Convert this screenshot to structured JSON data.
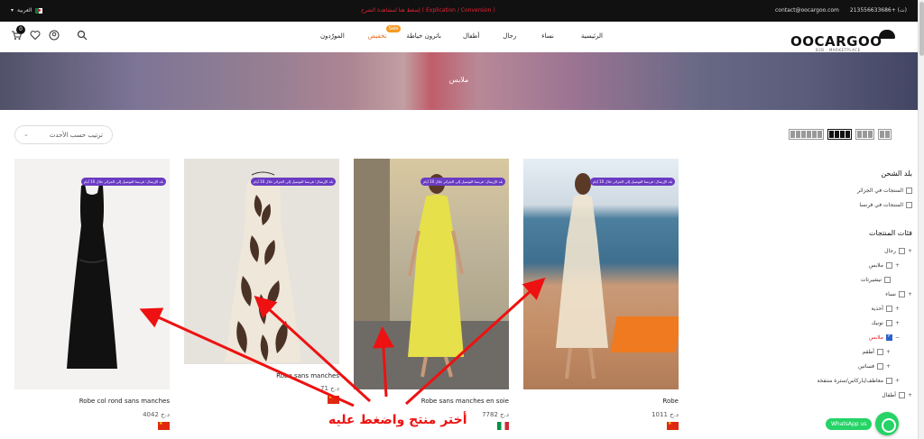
{
  "topbar": {
    "language": "العربية",
    "promo": "إضغط هنا لمشاهدة الشرح ( Explication / Conversion )",
    "phone": "213556633686+ (ت)",
    "email": "contact@oocargoo.com"
  },
  "header": {
    "logo_text": "OOCARGOO",
    "logo_sub": "B2B · MARKETPLACE",
    "cart_count": "0",
    "nav": [
      {
        "label": "الرئيسية"
      },
      {
        "label": "نساء"
      },
      {
        "label": "رجال"
      },
      {
        "label": "أطفال"
      },
      {
        "label": "باترون خياطة"
      },
      {
        "label": "تخفيض",
        "badge": "Sale"
      },
      {
        "label": "المورّدون"
      }
    ]
  },
  "banner": {
    "title": "ملابس"
  },
  "toolbar": {
    "sort_label": "ترتيب حسب الأحدث"
  },
  "products": [
    {
      "name": "Robe col rond sans manches",
      "price": "4042 د.ج",
      "tag": "بلد الإرسال: فرنسا التوصيل إلى الجزائر خلال 10 أيام",
      "origin": "China"
    },
    {
      "name": "Robe sans manches",
      "price": "71 د.ج",
      "tag": "بلد الإرسال: فرنسا التوصيل إلى الجزائر خلال 10 أيام",
      "origin": "China"
    },
    {
      "name": "Robe sans manches en soie",
      "price": "7782 د.ج",
      "tag": "بلد الإرسال: فرنسا التوصيل إلى الجزائر خلال 10 أيام",
      "origin": "Italy"
    },
    {
      "name": "Robe",
      "price": "1011 د.ج",
      "tag": "بلد الإرسال: فرنسا التوصيل إلى الجزائر خلال 10 أيام",
      "origin": "China"
    }
  ],
  "sidebar": {
    "shipping_title": "بلد الشحن",
    "shipping_options": [
      "المنتجات في الجزائر",
      "المنتجات في فرنسا"
    ],
    "categories_title": "فئات المنتجات",
    "categories": [
      {
        "label": "رجال",
        "checked": false
      },
      {
        "label": "ملابس",
        "checked": false
      },
      {
        "label": "تيشيرتات",
        "checked": false
      },
      {
        "label": "نساء",
        "checked": false
      },
      {
        "label": "أحذية",
        "checked": false
      },
      {
        "label": "تونيك",
        "checked": false
      },
      {
        "label": "ملابس",
        "checked": true
      },
      {
        "label": "أطقم",
        "checked": false
      },
      {
        "label": "فساتين",
        "checked": false
      },
      {
        "label": "معاطف/باركاس/سترة منتفخة",
        "checked": false
      },
      {
        "label": "أطفال",
        "checked": false
      }
    ]
  },
  "annotation": "أختر منتج واضغط عليه",
  "whatsapp": {
    "label": "WhatsApp us"
  },
  "colors": {
    "accent": "#e86a1a",
    "tag": "#6a3cc2",
    "annotation": "#e11111",
    "whatsapp": "#25d366"
  }
}
